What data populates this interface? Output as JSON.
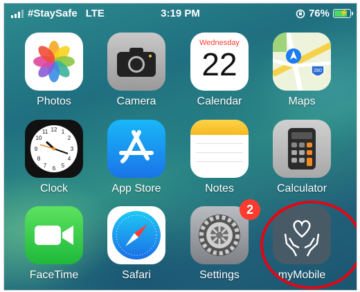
{
  "status_bar": {
    "carrier": "#StaySafe",
    "network": "LTE",
    "time": "3:19 PM",
    "battery_percent": "76%"
  },
  "calendar": {
    "weekday": "Wednesday",
    "day": "22"
  },
  "maps": {
    "shield": "280"
  },
  "apps": [
    {
      "label": "Photos",
      "icon": "photos-icon"
    },
    {
      "label": "Camera",
      "icon": "camera-icon"
    },
    {
      "label": "Calendar",
      "icon": "calendar-icon"
    },
    {
      "label": "Maps",
      "icon": "maps-icon"
    },
    {
      "label": "Clock",
      "icon": "clock-icon"
    },
    {
      "label": "App Store",
      "icon": "app-store-icon"
    },
    {
      "label": "Notes",
      "icon": "notes-icon"
    },
    {
      "label": "Calculator",
      "icon": "calculator-icon"
    },
    {
      "label": "FaceTime",
      "icon": "facetime-icon"
    },
    {
      "label": "Safari",
      "icon": "safari-icon"
    },
    {
      "label": "Settings",
      "icon": "settings-icon",
      "badge": "2"
    },
    {
      "label": "myMobile",
      "icon": "mymobile-icon"
    }
  ],
  "colors": {
    "badge": "#ff3b30",
    "highlight_circle": "#e30613",
    "battery_fill": "#4cd964"
  }
}
